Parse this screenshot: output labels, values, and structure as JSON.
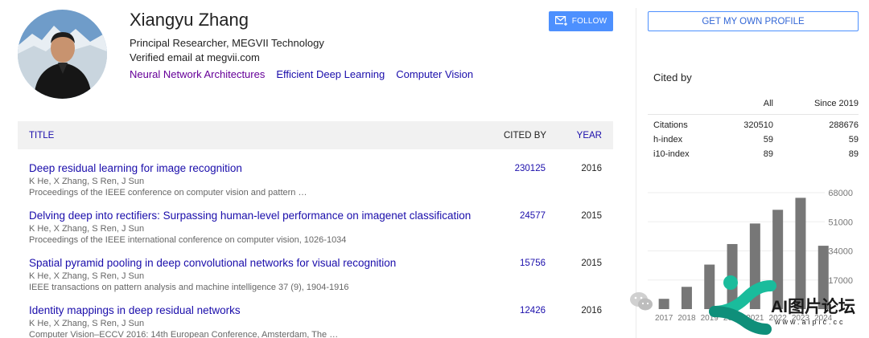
{
  "profile": {
    "name": "Xiangyu Zhang",
    "affiliation": "Principal Researcher, MEGVII Technology",
    "email": "Verified email at megvii.com",
    "interests": [
      "Neural Network Architectures",
      "Efficient Deep Learning",
      "Computer Vision"
    ],
    "follow_label": "FOLLOW"
  },
  "table": {
    "col_title": "TITLE",
    "col_cited": "CITED BY",
    "col_year": "YEAR",
    "rows": [
      {
        "title": "Deep residual learning for image recognition",
        "authors": "K He, X Zhang, S Ren, J Sun",
        "venue": "Proceedings of the IEEE conference on computer vision and pattern …",
        "cited": "230125",
        "year": "2016"
      },
      {
        "title": "Delving deep into rectifiers: Surpassing human-level performance on imagenet classification",
        "authors": "K He, X Zhang, S Ren, J Sun",
        "venue": "Proceedings of the IEEE international conference on computer vision, 1026-1034",
        "cited": "24577",
        "year": "2015"
      },
      {
        "title": "Spatial pyramid pooling in deep convolutional networks for visual recognition",
        "authors": "K He, X Zhang, S Ren, J Sun",
        "venue": "IEEE transactions on pattern analysis and machine intelligence 37 (9), 1904-1916",
        "cited": "15756",
        "year": "2015"
      },
      {
        "title": "Identity mappings in deep residual networks",
        "authors": "K He, X Zhang, S Ren, J Sun",
        "venue": "Computer Vision–ECCV 2016: 14th European Conference, Amsterdam, The …",
        "cited": "12426",
        "year": "2016"
      }
    ]
  },
  "sidebar": {
    "profile_button": "GET MY OWN PROFILE",
    "cited_by_title": "Cited by",
    "metrics": {
      "col_all": "All",
      "col_since": "Since 2019",
      "rows": [
        {
          "label": "Citations",
          "all": "320510",
          "since": "288676"
        },
        {
          "label": "h-index",
          "all": "59",
          "since": "59"
        },
        {
          "label": "i10-index",
          "all": "89",
          "since": "89"
        }
      ]
    }
  },
  "chart_data": {
    "type": "bar",
    "categories": [
      "2017",
      "2018",
      "2019",
      "2020",
      "2021",
      "2022",
      "2023",
      "2024"
    ],
    "values": [
      6000,
      13000,
      26000,
      38000,
      50000,
      58000,
      65000,
      37000
    ],
    "yticks": [
      "68000",
      "51000",
      "34000",
      "17000"
    ],
    "ytick_values": [
      68000,
      51000,
      34000,
      17000
    ],
    "ylim": [
      0,
      68000
    ],
    "bar_color": "#777777"
  },
  "overlay": {
    "watermark_text": "AI图片论坛",
    "watermark_url": "www.aipic.cc",
    "watermark_colors": [
      "#1abc9c",
      "#0f8f7a"
    ]
  },
  "colors": {
    "link": "#1a0dab",
    "visited": "#660099",
    "accent": "#4d90fe"
  }
}
